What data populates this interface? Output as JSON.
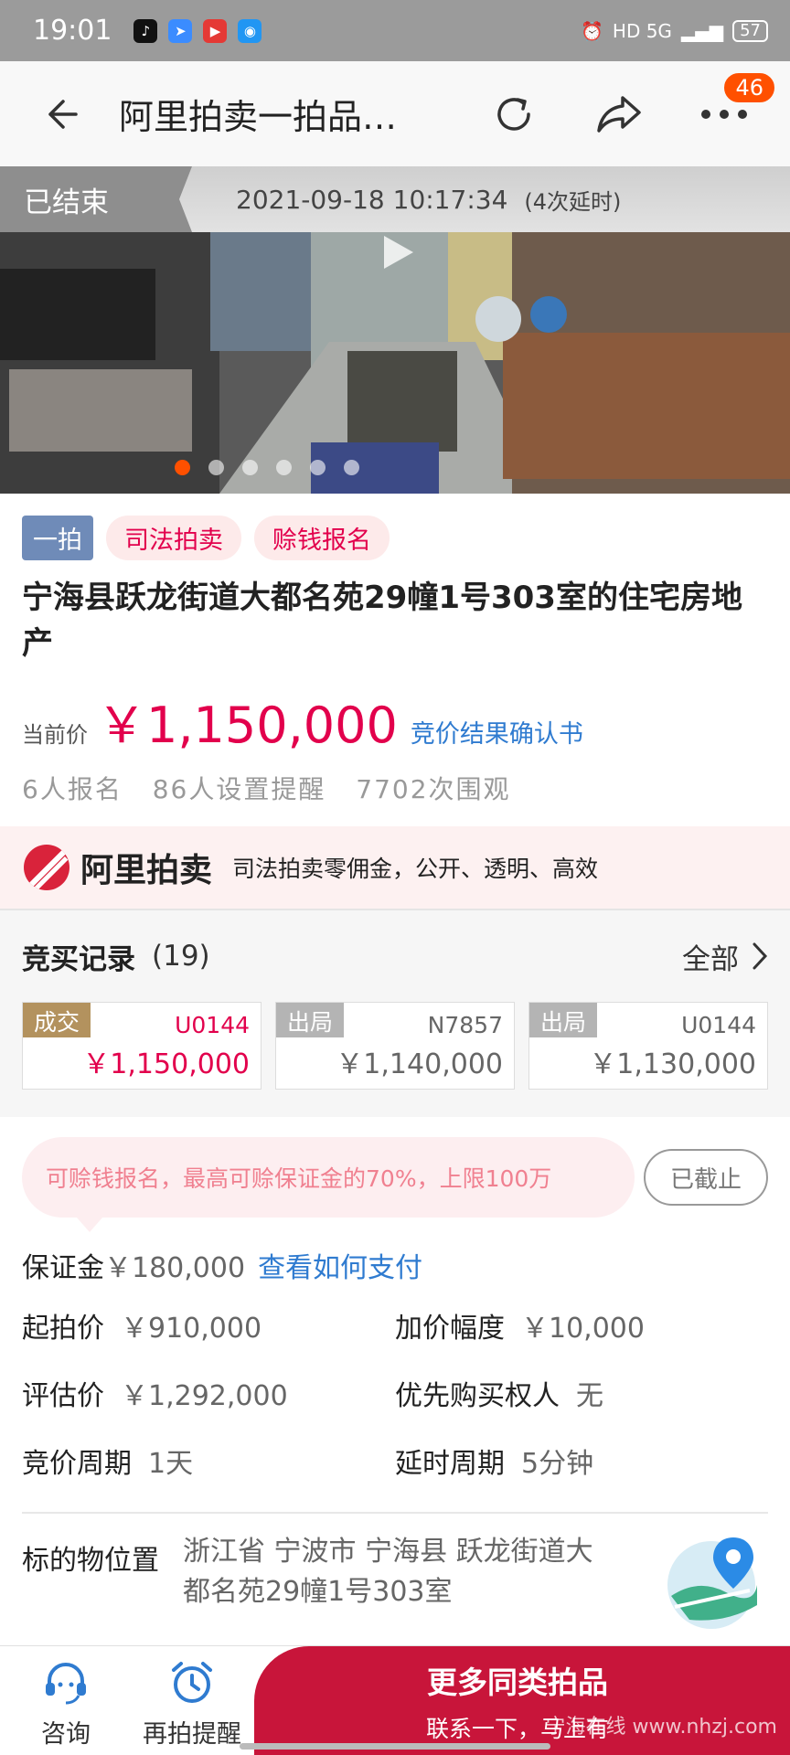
{
  "status_bar": {
    "time": "19:01",
    "network": "HD 5G",
    "battery": "57"
  },
  "nav": {
    "title": "阿里拍卖一拍品…",
    "badge": "46"
  },
  "end_strip": {
    "status": "已结束",
    "end_time": "2021-09-18 10:17:34",
    "extensions": "(4次延时)"
  },
  "gallery": {
    "count": 6,
    "active_index": 0
  },
  "item": {
    "tags": [
      "一拍",
      "司法拍卖",
      "赊钱报名"
    ],
    "title": "宁海县跃龙街道大都名苑29幢1号303室的住宅房地产",
    "price_label": "当前价",
    "price": "￥1,150,000",
    "confirm_link": "竞价结果确认书",
    "stats": [
      "6人报名",
      "86人设置提醒",
      "7702次围观"
    ]
  },
  "ali_banner": {
    "brand": "阿里拍卖",
    "slogan": "司法拍卖零佣金，公开、透明、高效"
  },
  "records": {
    "title": "竞买记录",
    "count": "(19)",
    "all_label": "全部",
    "items": [
      {
        "status": "成交",
        "user": "U0144",
        "price": "￥1,150,000"
      },
      {
        "status": "出局",
        "user": "N7857",
        "price": "￥1,140,000"
      },
      {
        "status": "出局",
        "user": "U0144",
        "price": "￥1,130,000"
      }
    ]
  },
  "deposit": {
    "bubble_text": "可赊钱报名，最高可赊保证金的70%，上限100万",
    "closed_label": "已截止",
    "deposit_label": "保证金",
    "deposit_value": "￥180,000",
    "pay_link": "查看如何支付",
    "details": [
      {
        "k": "起拍价",
        "v": "￥910,000"
      },
      {
        "k": "加价幅度",
        "v": "￥10,000"
      },
      {
        "k": "评估价",
        "v": "￥1,292,000"
      },
      {
        "k": "优先购买权人",
        "v": "无"
      },
      {
        "k": "竞价周期",
        "v": "1天"
      },
      {
        "k": "延时周期",
        "v": "5分钟"
      }
    ],
    "location_label": "标的物位置",
    "location_value": "浙江省 宁波市 宁海县 跃龙街道大都名苑29幢1号303室"
  },
  "bottom": {
    "consult": "咨询",
    "remind": "再拍提醒",
    "cta_main": "更多同类拍品",
    "cta_sub": "联系一下，马上有",
    "watermark": "宁海在线 www.nhzj.com"
  },
  "colors": {
    "price_red": "#e2004c",
    "link_blue": "#2f7bd0",
    "cta_red": "#c8153a",
    "badge_orange": "#ff5000"
  }
}
